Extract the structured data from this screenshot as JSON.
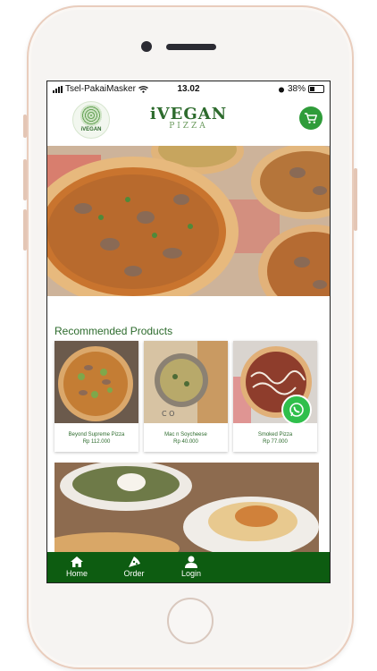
{
  "status": {
    "carrier": "Tsel-PakaiMasker",
    "time": "13.02",
    "battery": "38%"
  },
  "header": {
    "logo_text": "iVEGAN",
    "brand_name": "iVEGAN",
    "brand_sub": "PIZZA",
    "cart_icon": "cart-icon"
  },
  "recommended": {
    "title": "Recommended Products",
    "products": [
      {
        "name": "Beyond Supreme Pizza",
        "price": "Rp 112.000"
      },
      {
        "name": "Mac n Soycheese",
        "price": "Rp 40.000"
      },
      {
        "name": "Smoked Pizza",
        "price": "Rp 77.000"
      }
    ]
  },
  "nav": {
    "items": [
      {
        "label": "Home",
        "icon": "home-icon"
      },
      {
        "label": "Order",
        "icon": "pizza-slice-icon"
      },
      {
        "label": "Login",
        "icon": "user-icon"
      }
    ]
  },
  "colors": {
    "brand_green": "#2d6b2d",
    "nav_green": "#0d5c11",
    "cart_green": "#2f9c3a",
    "whatsapp_green": "#2fbf4b"
  }
}
